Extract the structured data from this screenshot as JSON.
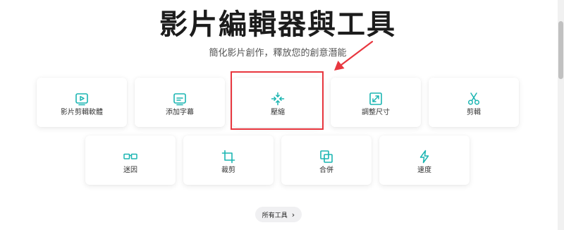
{
  "header": {
    "title": "影片編輯器與工具",
    "subtitle": "簡化影片創作，釋放您的創意潛能"
  },
  "tools_row1": [
    {
      "label": "影片剪輯軟體",
      "icon": "video-play-icon"
    },
    {
      "label": "添加字幕",
      "icon": "subtitle-icon"
    },
    {
      "label": "壓縮",
      "icon": "compress-icon"
    },
    {
      "label": "調整尺寸",
      "icon": "resize-icon"
    },
    {
      "label": "剪輯",
      "icon": "scissors-icon"
    }
  ],
  "tools_row2": [
    {
      "label": "迷因",
      "icon": "meme-glasses-icon"
    },
    {
      "label": "裁剪",
      "icon": "crop-icon"
    },
    {
      "label": "合併",
      "icon": "merge-icon"
    },
    {
      "label": "速度",
      "icon": "lightning-icon"
    }
  ],
  "footer": {
    "all_tools_label": "所有工具"
  },
  "colors": {
    "accent": "#1bb5b2",
    "annotation": "#e8373f",
    "title": "#1c1c1c"
  }
}
